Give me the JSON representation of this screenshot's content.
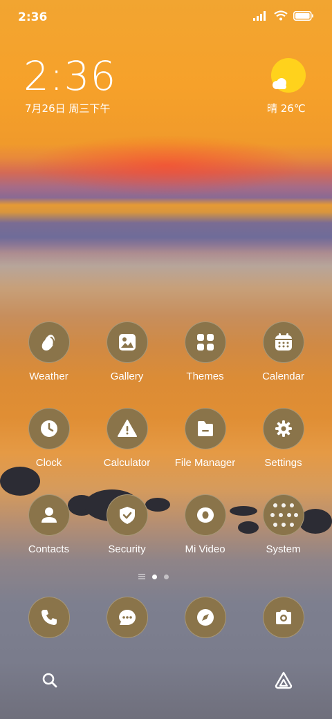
{
  "status": {
    "time": "2:36"
  },
  "lockclock": {
    "time": "2:36",
    "date": "7月26日 周三下午"
  },
  "weather": {
    "text": "晴 26℃"
  },
  "apps": [
    {
      "label": "Weather"
    },
    {
      "label": "Gallery"
    },
    {
      "label": "Themes"
    },
    {
      "label": "Calendar"
    },
    {
      "label": "Clock"
    },
    {
      "label": "Calculator"
    },
    {
      "label": "File Manager"
    },
    {
      "label": "Settings"
    },
    {
      "label": "Contacts"
    },
    {
      "label": "Security"
    },
    {
      "label": "Mi Video"
    },
    {
      "label": "System"
    }
  ],
  "dock": [
    "phone-icon",
    "messages-icon",
    "browser-icon",
    "camera-icon"
  ],
  "colors": {
    "icon_bg": "#8a744a",
    "sun": "#ffd21c"
  }
}
